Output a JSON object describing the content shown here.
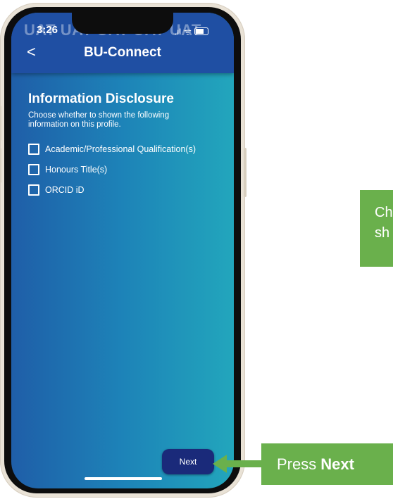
{
  "status_bar": {
    "time": "3:26",
    "signal": ".ıl",
    "wifi": "ᯤ"
  },
  "header": {
    "watermark": "UAT UAT UAT UAT UAT",
    "back_symbol": "<",
    "title": "BU-Connect"
  },
  "content": {
    "title": "Information Disclosure",
    "description": "Choose whether to shown the following information on this profile.",
    "options": [
      {
        "label": "Academic/Professional Qualification(s)",
        "checked": false
      },
      {
        "label": "Honours Title(s)",
        "checked": false
      },
      {
        "label": "ORCID iD",
        "checked": false
      }
    ],
    "next_label": "Next"
  },
  "callouts": {
    "top_line1": "Ch",
    "top_line2": "sh",
    "bottom_prefix": "Press",
    "bottom_bold": "Next",
    "color": "#6ab04c"
  }
}
